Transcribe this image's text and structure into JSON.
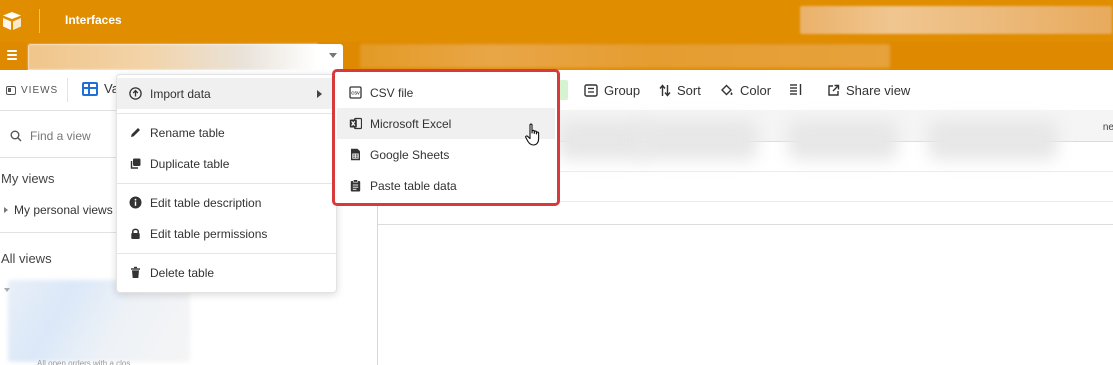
{
  "topbar": {
    "title": "Interfaces"
  },
  "viewbar": {
    "views_label": "VIEWS",
    "view_name": "Va",
    "toolbar": [
      {
        "id": "group",
        "label": "Group",
        "icon": "group-icon"
      },
      {
        "id": "sort",
        "label": "Sort",
        "icon": "sort-icon"
      },
      {
        "id": "color",
        "label": "Color",
        "icon": "paint-bucket-icon"
      },
      {
        "id": "row-height",
        "label": "",
        "icon": "row-height-icon"
      },
      {
        "id": "share",
        "label": "Share view",
        "icon": "share-icon"
      }
    ]
  },
  "grid": {
    "column_end_text": "ne"
  },
  "sidebar": {
    "search_placeholder": "Find a view",
    "my_views_heading": "My views",
    "my_personal_views": "My personal views",
    "all_views_heading": "All views",
    "footer_text": "All open orders with a clos"
  },
  "context_menu": {
    "items": [
      {
        "label": "Import data",
        "icon": "import-icon",
        "has_submenu": true
      },
      {
        "label": "Rename table",
        "icon": "pencil-icon"
      },
      {
        "label": "Duplicate table",
        "icon": "duplicate-icon"
      },
      {
        "label": "Edit table description",
        "icon": "info-icon"
      },
      {
        "label": "Edit table permissions",
        "icon": "lock-icon"
      },
      {
        "label": "Delete table",
        "icon": "trash-icon"
      }
    ]
  },
  "import_submenu": {
    "items": [
      {
        "label": "CSV file",
        "icon": "csv-file-icon"
      },
      {
        "label": "Microsoft Excel",
        "icon": "excel-icon"
      },
      {
        "label": "Google Sheets",
        "icon": "google-sheets-icon"
      },
      {
        "label": "Paste table data",
        "icon": "clipboard-icon"
      }
    ]
  },
  "colors": {
    "brand": "#e08d00",
    "highlight_border": "#d63a3a",
    "view_icon": "#1f6fd6"
  }
}
